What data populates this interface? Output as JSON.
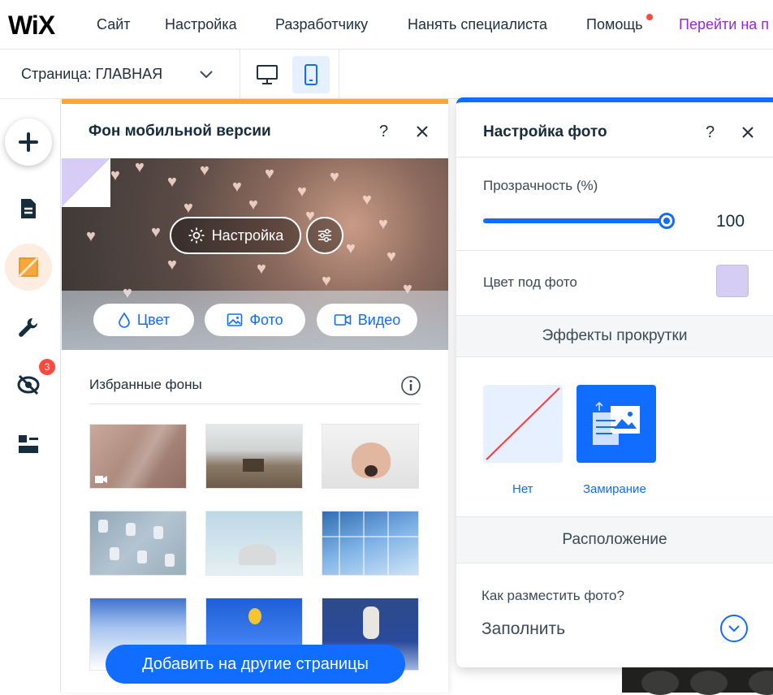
{
  "topbar": {
    "logo": "WiX",
    "menu": [
      "Сайт",
      "Настройка",
      "Разработчику",
      "Нанять специалиста",
      "Помощь"
    ],
    "upgrade_link": "Перейти на п"
  },
  "pagebar": {
    "page_label": "Страница: ГЛАВНАЯ",
    "devices": [
      "desktop",
      "mobile"
    ],
    "active_device": "mobile"
  },
  "rail": {
    "items": [
      "add",
      "pages",
      "background",
      "settings",
      "hidden-elements",
      "layouts"
    ],
    "hidden_badge": "3"
  },
  "left_panel": {
    "title": "Фон мобильной версии",
    "settings_button": "Настройка",
    "buttons": {
      "color": "Цвет",
      "photo": "Фото",
      "video": "Видео"
    },
    "favorites_title": "Избранные фоны",
    "cta": "Добавить на другие страницы"
  },
  "right_panel": {
    "title": "Настройка фото",
    "opacity_label": "Прозрачность (%)",
    "opacity_value": "100",
    "opacity_fraction": 1.0,
    "under_color_label": "Цвет под фото",
    "under_color": "#d5cdf2",
    "scroll_effects_title": "Эффекты прокрутки",
    "effects": [
      {
        "label": "Нет",
        "selected": false
      },
      {
        "label": "Замирание",
        "selected": true
      }
    ],
    "position_title": "Расположение",
    "fit_question": "Как разместить фото?",
    "fit_value": "Заполнить"
  },
  "colors": {
    "accent": "#116dff",
    "left_panel_top": "#f5a73b",
    "upgrade_purple": "#9a27d5",
    "notification": "#ff4a3d"
  }
}
